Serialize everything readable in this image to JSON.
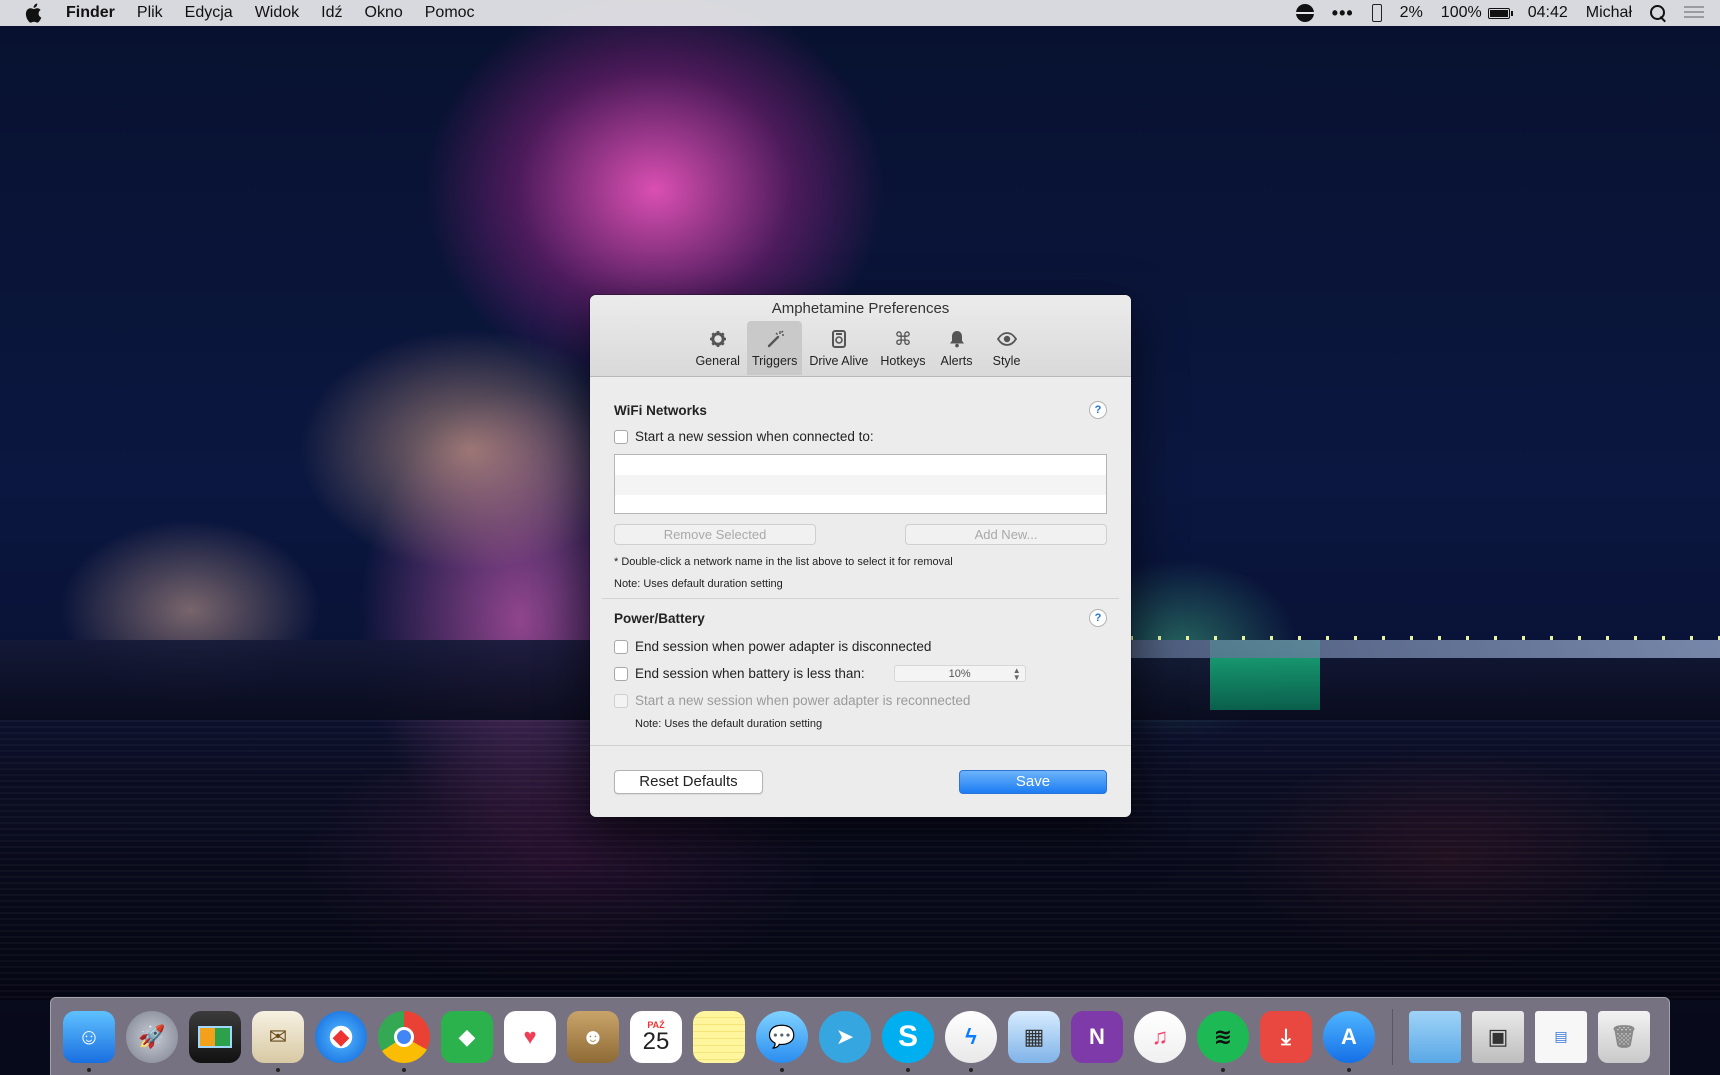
{
  "menubar": {
    "app_name": "Finder",
    "items": [
      "Plik",
      "Edycja",
      "Widok",
      "Idź",
      "Okno",
      "Pomoc"
    ],
    "status": {
      "phone_battery": "2%",
      "battery": "100%",
      "time": "04:42",
      "user": "Michał"
    }
  },
  "window": {
    "title": "Amphetamine Preferences",
    "tabs": [
      {
        "label": "General",
        "icon": "gear-icon"
      },
      {
        "label": "Triggers",
        "icon": "magic-wand-icon"
      },
      {
        "label": "Drive Alive",
        "icon": "drive-icon"
      },
      {
        "label": "Hotkeys",
        "icon": "command-key-icon"
      },
      {
        "label": "Alerts",
        "icon": "bell-icon"
      },
      {
        "label": "Style",
        "icon": "eye-icon"
      }
    ],
    "active_tab": "Triggers",
    "wifi": {
      "title": "WiFi Networks",
      "help": "?",
      "start_session_label": "Start a new session when connected to:",
      "remove_label": "Remove Selected",
      "add_label": "Add New...",
      "hint": "* Double-click a network name in the list above to select it for removal",
      "note": "Note: Uses default duration setting"
    },
    "power": {
      "title": "Power/Battery",
      "help": "?",
      "end_adapter_label": "End session when power adapter is disconnected",
      "end_battery_label": "End session when battery is less than:",
      "battery_threshold": "10%",
      "restart_label": "Start a new session when power adapter is reconnected",
      "note": "Note: Uses the default duration setting"
    },
    "footer": {
      "reset_label": "Reset Defaults",
      "save_label": "Save"
    }
  },
  "dock": {
    "calendar_month": "PAŹ",
    "calendar_day": "25",
    "items": [
      "finder-icon",
      "launchpad-icon",
      "mission-control-icon",
      "mail-icon",
      "safari-icon",
      "chrome-icon",
      "feedly-icon",
      "pocket-icon",
      "contacts-icon",
      "calendar-icon",
      "notes-icon",
      "messages-icon",
      "telegram-icon",
      "skype-icon",
      "messenger-icon",
      "preview-icon",
      "onenote-icon",
      "itunes-icon",
      "spotify-icon",
      "downloader-icon",
      "app-store-icon",
      "downloads-folder-icon",
      "photo-stack-icon",
      "documents-stack-icon",
      "trash-icon"
    ]
  }
}
